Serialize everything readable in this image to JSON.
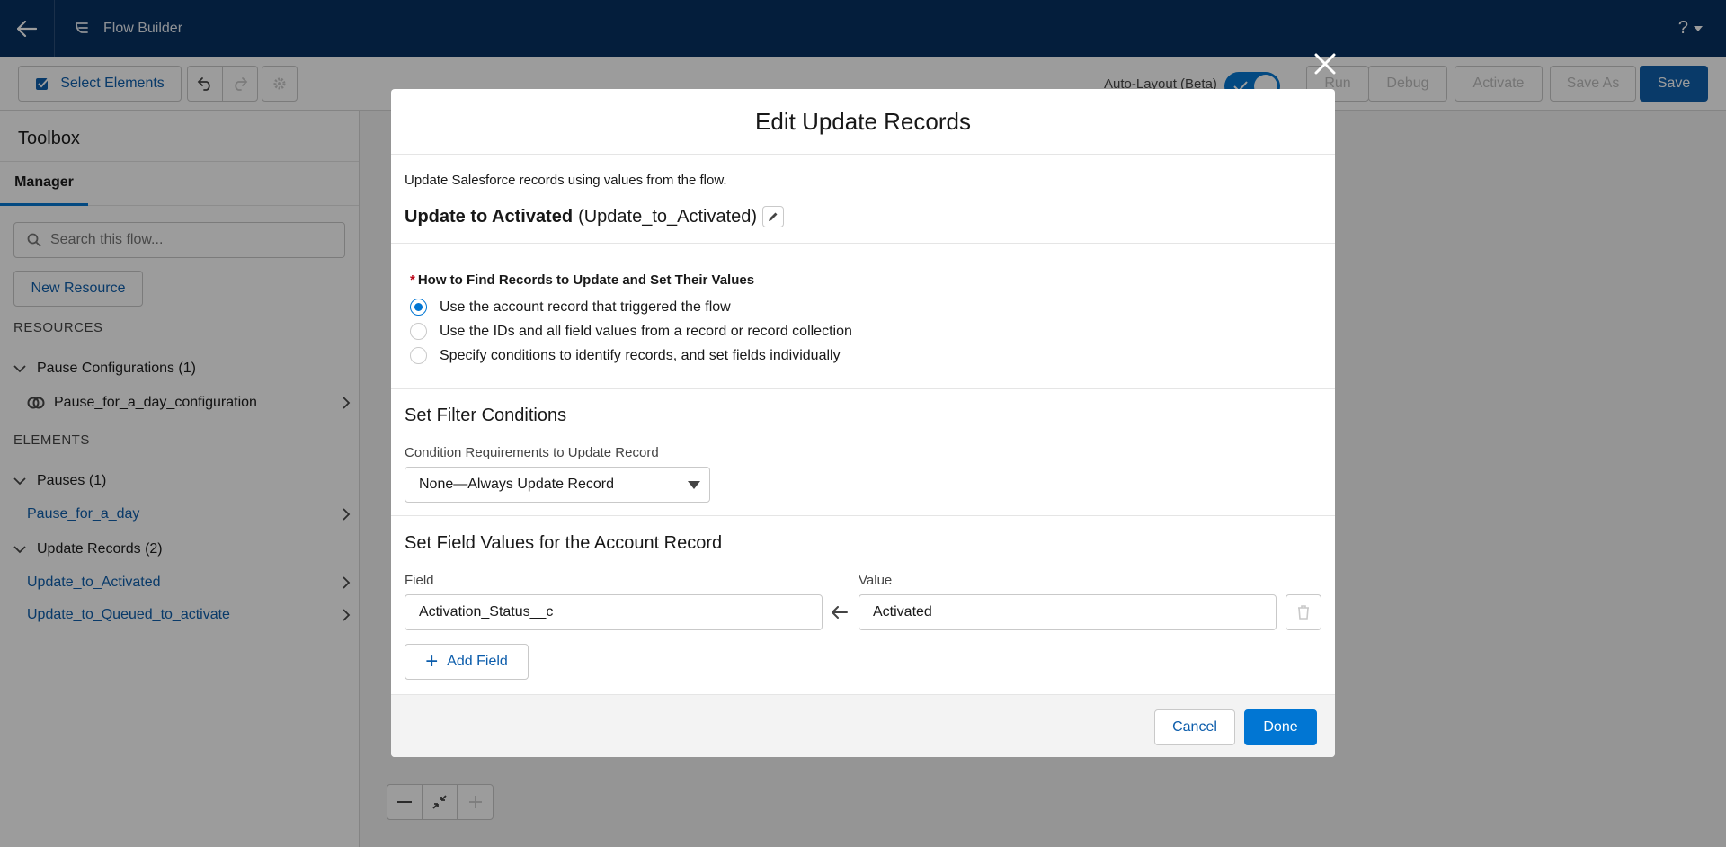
{
  "header": {
    "app_title": "Flow Builder",
    "help_label": "?"
  },
  "toolbar": {
    "select_elements": "Select Elements",
    "auto_layout_label": "Auto-Layout (Beta)",
    "auto_layout_on": true,
    "run": "Run",
    "debug": "Debug",
    "activate": "Activate",
    "save_as": "Save As",
    "save": "Save"
  },
  "sidebar": {
    "title": "Toolbox",
    "tab": "Manager",
    "search_placeholder": "Search this flow...",
    "new_resource": "New Resource",
    "resources_label": "RESOURCES",
    "resources": [
      {
        "group": "Pause Configurations (1)",
        "items": [
          "Pause_for_a_day_configuration"
        ]
      }
    ],
    "elements_label": "ELEMENTS",
    "elements": [
      {
        "group": "Pauses (1)",
        "items": [
          "Pause_for_a_day"
        ]
      },
      {
        "group": "Update Records (2)",
        "items": [
          "Update_to_Activated",
          "Update_to_Queued_to_activate"
        ]
      }
    ]
  },
  "modal": {
    "title": "Edit Update Records",
    "description": "Update Salesforce records using values from the flow.",
    "element_label": "Update to Activated",
    "element_api_name": "(Update_to_Activated)",
    "question_required": "*",
    "question": "How to Find Records to Update and Set Their Values",
    "options": [
      {
        "label": "Use the account record that triggered the flow",
        "checked": true
      },
      {
        "label": "Use the IDs and all field values from a record or record collection",
        "checked": false
      },
      {
        "label": "Specify conditions to identify records, and set fields individually",
        "checked": false
      }
    ],
    "filter_title": "Set Filter Conditions",
    "condition_label": "Condition Requirements to Update Record",
    "condition_value": "None—Always Update Record",
    "field_values_title": "Set Field Values for the Account Record",
    "field_label": "Field",
    "field_value": "Activation_Status__c",
    "value_label": "Value",
    "value_value": "Activated",
    "add_field": "Add Field",
    "cancel": "Cancel",
    "done": "Done"
  },
  "colors": {
    "brand": "#0176d3",
    "header": "#032d60",
    "link": "#0b5cab"
  }
}
